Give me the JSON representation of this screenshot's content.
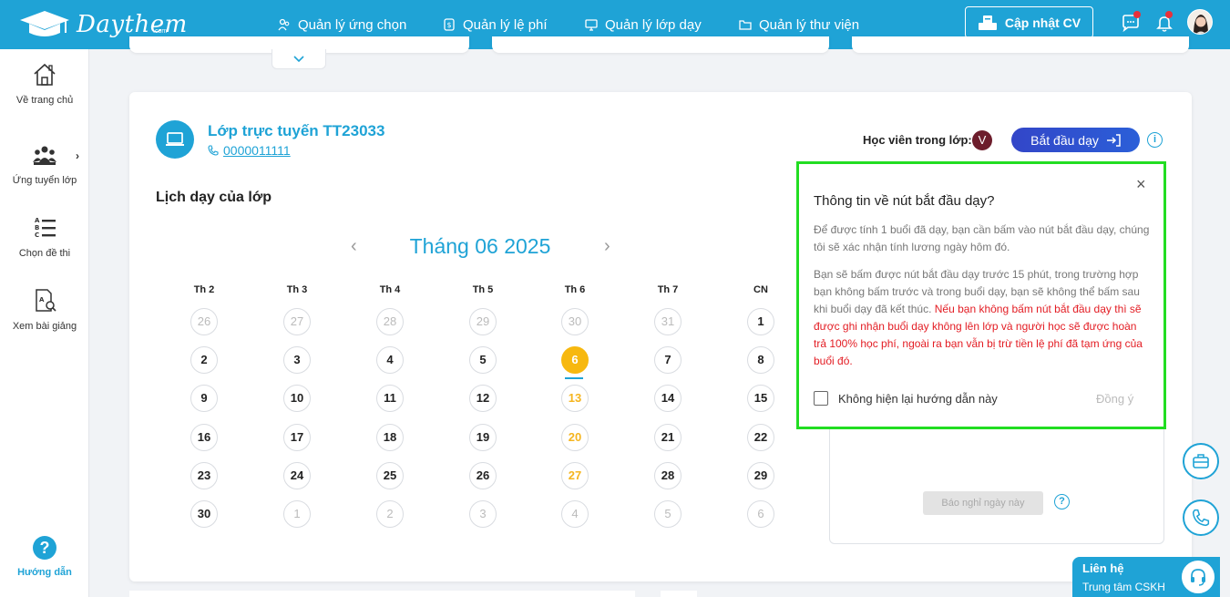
{
  "brand": {
    "name": "Daythem",
    "suffix": ".com"
  },
  "nav": {
    "items": [
      {
        "label": "Quản lý ứng chọn"
      },
      {
        "label": "Quản lý lệ phí"
      },
      {
        "label": "Quản lý lớp dạy"
      },
      {
        "label": "Quản lý thư viện"
      }
    ],
    "cv_button": "Cập nhật CV"
  },
  "sidebar": {
    "items": [
      {
        "label": "Về trang chủ"
      },
      {
        "label": "Ứng tuyển lớp"
      },
      {
        "label": "Chọn đề thi"
      },
      {
        "label": "Xem bài giảng"
      }
    ],
    "help": {
      "icon": "?",
      "label": "Hướng dẫn"
    },
    "expand_glyph": "›"
  },
  "class_info": {
    "title": "Lớp trực tuyến TT23033",
    "phone": "0000011111",
    "students_label": "Học viên trong lớp:",
    "student_initial": "V",
    "start_button": "Bắt đầu dạy",
    "info_glyph": "i"
  },
  "schedule": {
    "title": "Lịch dạy của lớp",
    "month": "Tháng 06 2025",
    "prev_glyph": "‹",
    "next_glyph": "›",
    "weekdays": [
      "Th 2",
      "Th 3",
      "Th 4",
      "Th 5",
      "Th 6",
      "Th 7",
      "CN"
    ],
    "weeks": [
      [
        "26",
        "27",
        "28",
        "29",
        "30",
        "31",
        "1"
      ],
      [
        "2",
        "3",
        "4",
        "5",
        "6",
        "7",
        "8"
      ],
      [
        "9",
        "10",
        "11",
        "12",
        "13",
        "14",
        "15"
      ],
      [
        "16",
        "17",
        "18",
        "19",
        "20",
        "21",
        "22"
      ],
      [
        "23",
        "24",
        "25",
        "26",
        "27",
        "28",
        "29"
      ],
      [
        "30",
        "1",
        "2",
        "3",
        "4",
        "5",
        "6"
      ]
    ],
    "today": "6"
  },
  "report": {
    "button": "Báo nghỉ ngày này",
    "help_glyph": "?"
  },
  "popup": {
    "close_glyph": "×",
    "title": "Thông tin về nút bắt đầu dạy?",
    "paragraph1": "Để được tính 1 buổi đã dạy, bạn cần bấm vào nút bắt đầu dạy, chúng tôi sẽ xác nhận tính lương ngày hôm đó.",
    "paragraph2_normal": "Bạn sẽ bấm được nút bắt đầu dạy trước 15 phút, trong trường hợp bạn không bấm trước và trong buổi dạy, bạn sẽ không thể bấm sau khi buổi dạy đã kết thúc. ",
    "paragraph2_warning": "Nếu bạn không bấm nút bắt đầu dạy thì sẽ được ghi nhận buổi dạy không lên lớp và người học sẽ được hoàn trả 100% học phí, ngoài ra bạn vẫn bị trừ tiền lệ phí đã tạm ứng của buổi đó.",
    "checkbox_label": "Không hiện lại hướng dẫn này",
    "agree_button": "Đồng ý"
  },
  "contact": {
    "title": "Liên hệ",
    "subtitle": "Trung tâm CSKH"
  },
  "colors": {
    "primary": "#1fa3d6",
    "today": "#f7b80f",
    "warning": "#e31c23",
    "highlight_border": "#22dd22",
    "start_button": "#3346c8"
  }
}
